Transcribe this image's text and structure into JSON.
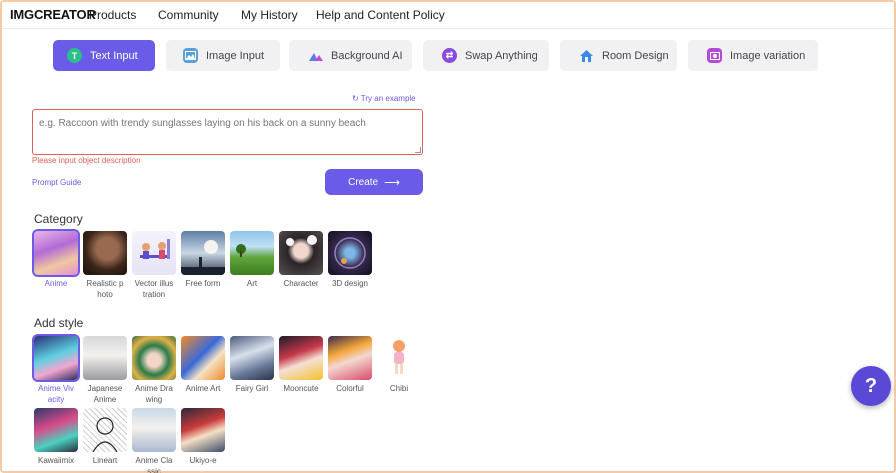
{
  "header": {
    "logo": "IMGCREATOR",
    "nav": [
      "Products",
      "Community",
      "My History",
      "Help and Content Policy"
    ]
  },
  "tabs": [
    {
      "label": "Text Input",
      "icon": "text-input-icon",
      "active": true
    },
    {
      "label": "Image Input",
      "icon": "image-input-icon",
      "active": false
    },
    {
      "label": "Background AI",
      "icon": "background-ai-icon",
      "active": false
    },
    {
      "label": "Swap Anything",
      "icon": "swap-anything-icon",
      "active": false
    },
    {
      "label": "Room Design",
      "icon": "room-design-icon",
      "active": false
    },
    {
      "label": "Image variation",
      "icon": "image-variation-icon",
      "active": false
    }
  ],
  "prompt": {
    "try_example": "Try an example",
    "placeholder": "e.g. Raccoon with trendy sunglasses laying on his back on a sunny beach",
    "value": "",
    "error": "Please input object description",
    "guide": "Prompt Guide",
    "create": "Create"
  },
  "category": {
    "title": "Category",
    "items": [
      "Anime",
      "Realistic p hoto",
      "Vector illus tration",
      "Free form",
      "Art",
      "Character",
      "3D design"
    ],
    "selected": "Anime"
  },
  "style": {
    "title": "Add style",
    "items": [
      "Anime Viv acity",
      "Japanese Anime",
      "Anime Dra wing",
      "Anime Art",
      "Fairy Girl",
      "Mooncute",
      "Colorful",
      "Chibi",
      "Kawaiimix",
      "Lineart",
      "Anime Cla ssic",
      "Ukiyo-e"
    ],
    "selected": "Anime Viv acity"
  },
  "help_label": "?",
  "colors": {
    "accent": "#6a5be8",
    "error": "#e0605a"
  }
}
